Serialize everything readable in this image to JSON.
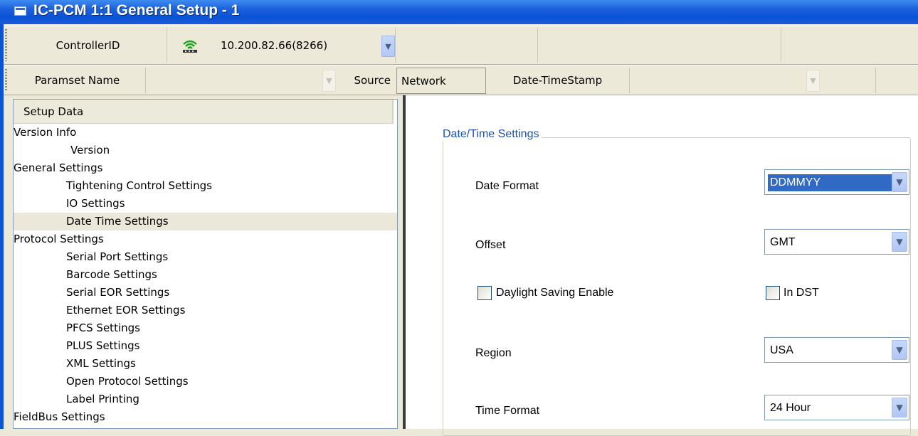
{
  "window": {
    "title": "IC-PCM 1:1 General Setup - 1"
  },
  "toolbar1": {
    "controller_label": "ControllerID",
    "controller_value": "10.200.82.66(8266)"
  },
  "toolbar2": {
    "paramset_label": "Paramset Name",
    "paramset_value": "",
    "source_label": "Source",
    "source_value": "Network",
    "datetime_label": "Date-TimeStamp",
    "datetime_value": ""
  },
  "tree": {
    "header": "Setup Data",
    "items": [
      {
        "label": "Version Info",
        "level": 0
      },
      {
        "label": "Version",
        "level": 2
      },
      {
        "label": "General Settings",
        "level": 0
      },
      {
        "label": "Tightening Control Settings",
        "level": 1
      },
      {
        "label": "IO Settings",
        "level": 1
      },
      {
        "label": "Date Time Settings",
        "level": 1,
        "selected": true
      },
      {
        "label": "Protocol Settings",
        "level": 0
      },
      {
        "label": "Serial Port Settings",
        "level": 1
      },
      {
        "label": "Barcode Settings",
        "level": 1
      },
      {
        "label": "Serial EOR Settings",
        "level": 1
      },
      {
        "label": "Ethernet EOR Settings",
        "level": 1
      },
      {
        "label": "PFCS Settings",
        "level": 1
      },
      {
        "label": "PLUS Settings",
        "level": 1
      },
      {
        "label": "XML Settings",
        "level": 1
      },
      {
        "label": "Open Protocol Settings",
        "level": 1
      },
      {
        "label": "Label Printing",
        "level": 1
      },
      {
        "label": "FieldBus Settings",
        "level": 0
      }
    ]
  },
  "datetime": {
    "group_title": "Date/Time Settings",
    "date_format_label": "Date Format",
    "date_format_value": "DDMMYY",
    "offset_label": "Offset",
    "offset_value": "GMT",
    "dst_enable_label": "Daylight Saving Enable",
    "dst_enable_checked": false,
    "in_dst_label": "In DST",
    "in_dst_checked": false,
    "region_label": "Region",
    "region_value": "USA",
    "time_format_label": "Time Format",
    "time_format_value": "24 Hour"
  }
}
